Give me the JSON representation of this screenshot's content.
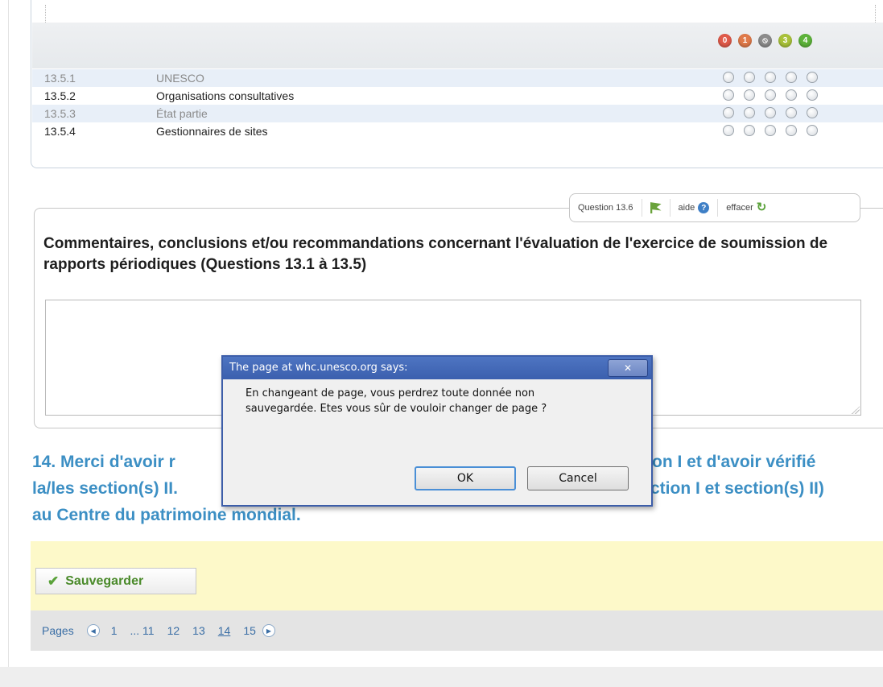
{
  "rating": {
    "scale": [
      {
        "label": "0",
        "color": "#e05a4a"
      },
      {
        "label": "1",
        "color": "#e07a4a"
      },
      {
        "label": "⦸",
        "color": "#8c8c8c"
      },
      {
        "label": "3",
        "color": "#a9c23a"
      },
      {
        "label": "4",
        "color": "#5db33a"
      }
    ],
    "rows": [
      {
        "num": "13.5.1",
        "label": "UNESCO"
      },
      {
        "num": "13.5.2",
        "label": "Organisations consultatives"
      },
      {
        "num": "13.5.3",
        "label": "État partie"
      },
      {
        "num": "13.5.4",
        "label": "Gestionnaires de sites"
      }
    ]
  },
  "question": {
    "number_label": "Question 13.6",
    "help_label": "aide",
    "clear_label": "effacer",
    "title": "Commentaires, conclusions et/ou recommandations concernant l'évaluation de l'exercice de soumission de rapports périodiques (Questions 13.1 à 13.5)",
    "answer_value": ""
  },
  "section14": {
    "line1_left": "14. Merci d'avoir r",
    "line1_right": "on I et d'avoir vérifié",
    "line2_left": "la/les section(s) II.",
    "line2_right": "ction I et section(s) II)",
    "line3": "au Centre du patrimoine mondial."
  },
  "save": {
    "label": "Sauvegarder"
  },
  "pager": {
    "label": "Pages",
    "pages": [
      "1",
      "... 11",
      "12",
      "13",
      "14",
      "15"
    ],
    "current": "14"
  },
  "dialog": {
    "title": "The page at whc.unesco.org says:",
    "close_glyph": "✕",
    "message_line1": "En changeant de page, vous perdrez toute donnée non",
    "message_line2": "sauvegardée. Etes vous sûr de vouloir changer de page ?",
    "ok_label": "OK",
    "cancel_label": "Cancel"
  }
}
